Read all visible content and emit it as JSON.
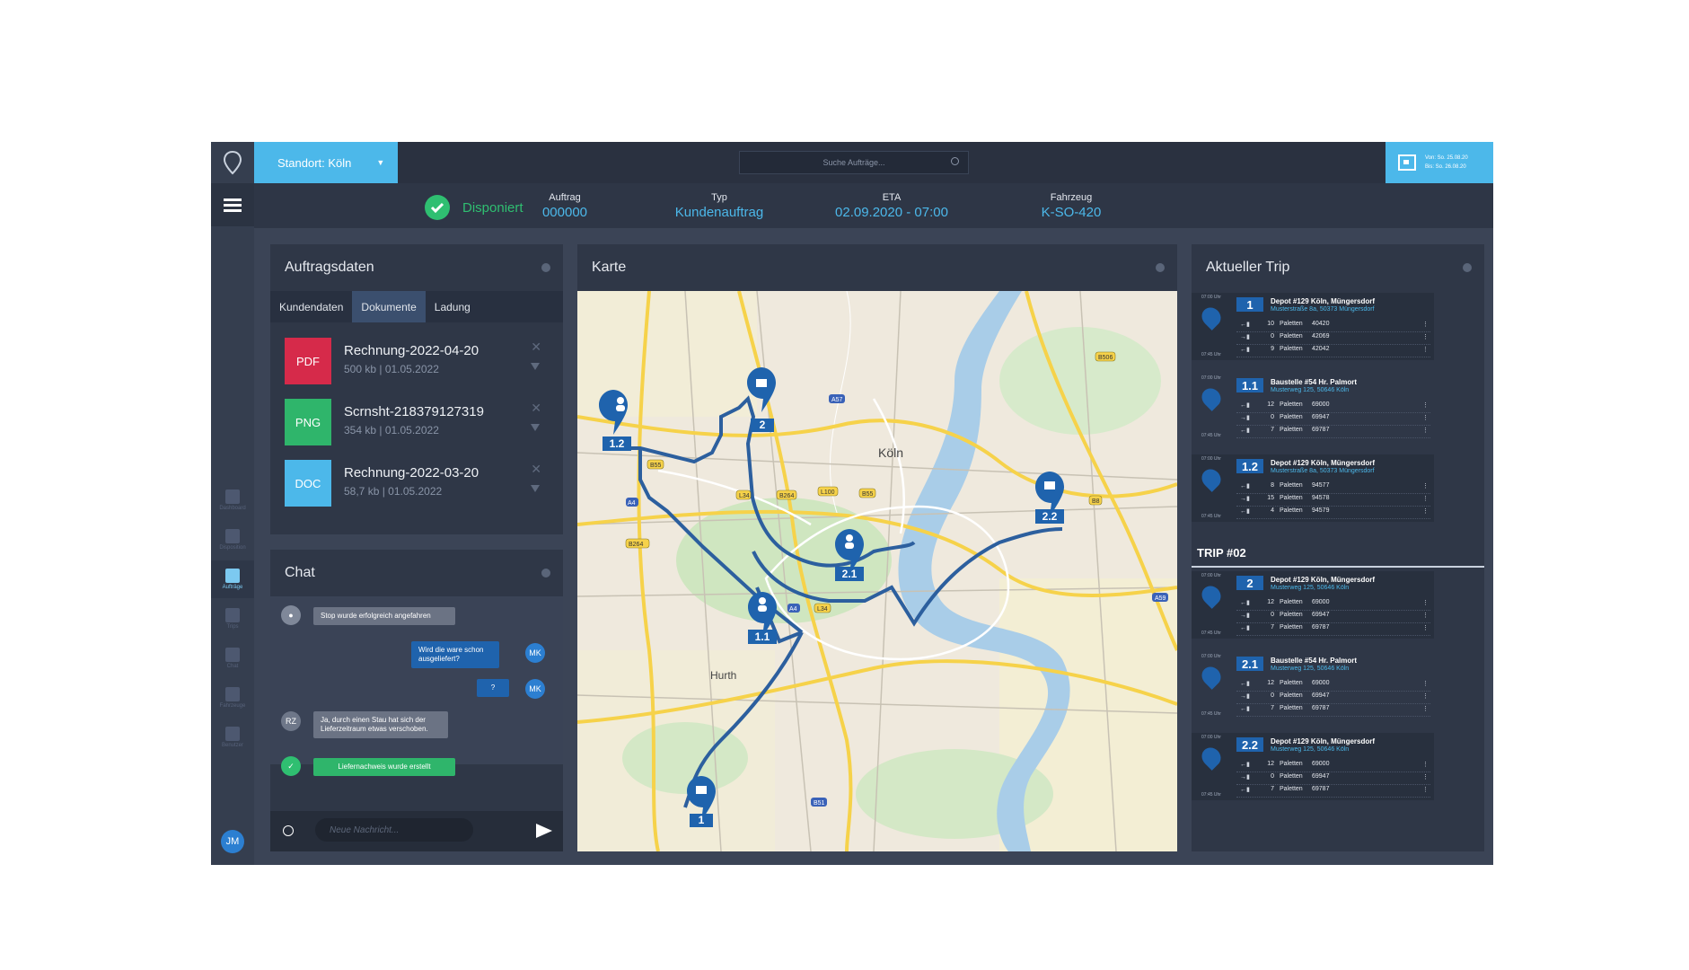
{
  "header": {
    "standort": "Standort: Köln",
    "search_placeholder": "Suche Aufträge...",
    "date_from": "Von:  So. 25.08.20",
    "date_to": "Bis:  So. 26.08.20"
  },
  "status": {
    "label": "Disponiert",
    "auftrag_label": "Auftrag",
    "auftrag_value": "000000",
    "typ_label": "Typ",
    "typ_value": "Kundenauftrag",
    "eta_label": "ETA",
    "eta_value": "02.09.2020 - 07:00",
    "fahrzeug_label": "Fahrzeug",
    "fahrzeug_value": "K-SO-420"
  },
  "nav": {
    "items": [
      "Dashboard",
      "Disposition",
      "Aufträge",
      "Trips",
      "Chat",
      "Fahrzeuge",
      "Benutzer"
    ],
    "active_index": 2,
    "user_initials": "JM"
  },
  "auftragsdaten": {
    "title": "Auftragsdaten",
    "tabs": [
      "Kundendaten",
      "Dokumente",
      "Ladung"
    ],
    "active_tab": 1,
    "documents": [
      {
        "type": "PDF",
        "name": "Rechnung-2022-04-20",
        "meta": "500 kb | 01.05.2022",
        "color": "#d62a4a"
      },
      {
        "type": "PNG",
        "name": "Scrnsht-218379127319",
        "meta": "354 kb | 01.05.2022",
        "color": "#2fb56b"
      },
      {
        "type": "DOC",
        "name": "Rechnung-2022-03-20",
        "meta": "58,7 kb | 01.05.2022",
        "color": "#4cb8ea"
      }
    ]
  },
  "chat": {
    "title": "Chat",
    "messages": {
      "system1": "Stop wurde erfolgreich angefahren",
      "mk1": "Wird die ware schon ausgeliefert?",
      "mk2": "?",
      "rz1": "Ja, durch einen Stau hat sich der Lieferzeitraum etwas verschoben.",
      "system2": "Liefernachweis wurde erstellt"
    },
    "avatar_mk": "MK",
    "avatar_rz": "RZ",
    "input_placeholder": "Neue Nachricht..."
  },
  "map": {
    "title": "Karte",
    "city_label": "Köln",
    "hurth_label": "Hurth",
    "road_labels": [
      "B506",
      "A57",
      "B55",
      "L34",
      "B264",
      "L100",
      "B55",
      "B8",
      "A59",
      "A4",
      "B264",
      "L34",
      "A4",
      "B51"
    ],
    "markers": [
      {
        "id": "1.2",
        "kind": "person"
      },
      {
        "id": "2",
        "kind": "depot"
      },
      {
        "id": "2.1",
        "kind": "person"
      },
      {
        "id": "2.2",
        "kind": "depot"
      },
      {
        "id": "1.1",
        "kind": "person"
      },
      {
        "id": "1",
        "kind": "depot"
      }
    ]
  },
  "trip": {
    "title": "Aktueller Trip",
    "trip2_label": "TRIP #02",
    "time_start": "07:00 Uhr",
    "time_end": "07:45 Uhr",
    "unit": "Paletten",
    "stops": [
      {
        "num": "1",
        "title": "Depot #129 Köln, Müngersdorf",
        "addr": "Musterstraße 8a, 50373 Müngersdorf",
        "rows": [
          {
            "q": "10",
            "code": "40420"
          },
          {
            "q": "0",
            "code": "42069"
          },
          {
            "q": "9",
            "code": "42042"
          }
        ]
      },
      {
        "num": "1.1",
        "title": "Baustelle #54 Hr. Palmort",
        "addr": "Musterweg 125, 50646 Köln",
        "rows": [
          {
            "q": "12",
            "code": "69000"
          },
          {
            "q": "0",
            "code": "69947"
          },
          {
            "q": "7",
            "code": "69787"
          }
        ]
      },
      {
        "num": "1.2",
        "title": "Depot #129 Köln, Müngersdorf",
        "addr": "Musterstraße 8a, 50373 Müngersdorf",
        "rows": [
          {
            "q": "8",
            "code": "94577"
          },
          {
            "q": "15",
            "code": "94578"
          },
          {
            "q": "4",
            "code": "94579"
          }
        ]
      },
      {
        "num": "2",
        "title": "Depot #129 Köln, Müngersdorf",
        "addr": "Musterweg 125, 50646 Köln",
        "rows": [
          {
            "q": "12",
            "code": "69000"
          },
          {
            "q": "0",
            "code": "69947"
          },
          {
            "q": "7",
            "code": "69787"
          }
        ]
      },
      {
        "num": "2.1",
        "title": "Baustelle #54 Hr. Palmort",
        "addr": "Musterweg 125, 50646 Köln",
        "rows": [
          {
            "q": "12",
            "code": "69000"
          },
          {
            "q": "0",
            "code": "69947"
          },
          {
            "q": "7",
            "code": "69787"
          }
        ]
      },
      {
        "num": "2.2",
        "title": "Depot #129 Köln, Müngersdorf",
        "addr": "Musterweg 125, 50646 Köln",
        "rows": [
          {
            "q": "12",
            "code": "69000"
          },
          {
            "q": "0",
            "code": "69947"
          },
          {
            "q": "7",
            "code": "69787"
          }
        ]
      }
    ]
  },
  "colors": {
    "accent": "#4cb8ea",
    "success": "#2fbf71",
    "route": "#2c5f9e"
  }
}
